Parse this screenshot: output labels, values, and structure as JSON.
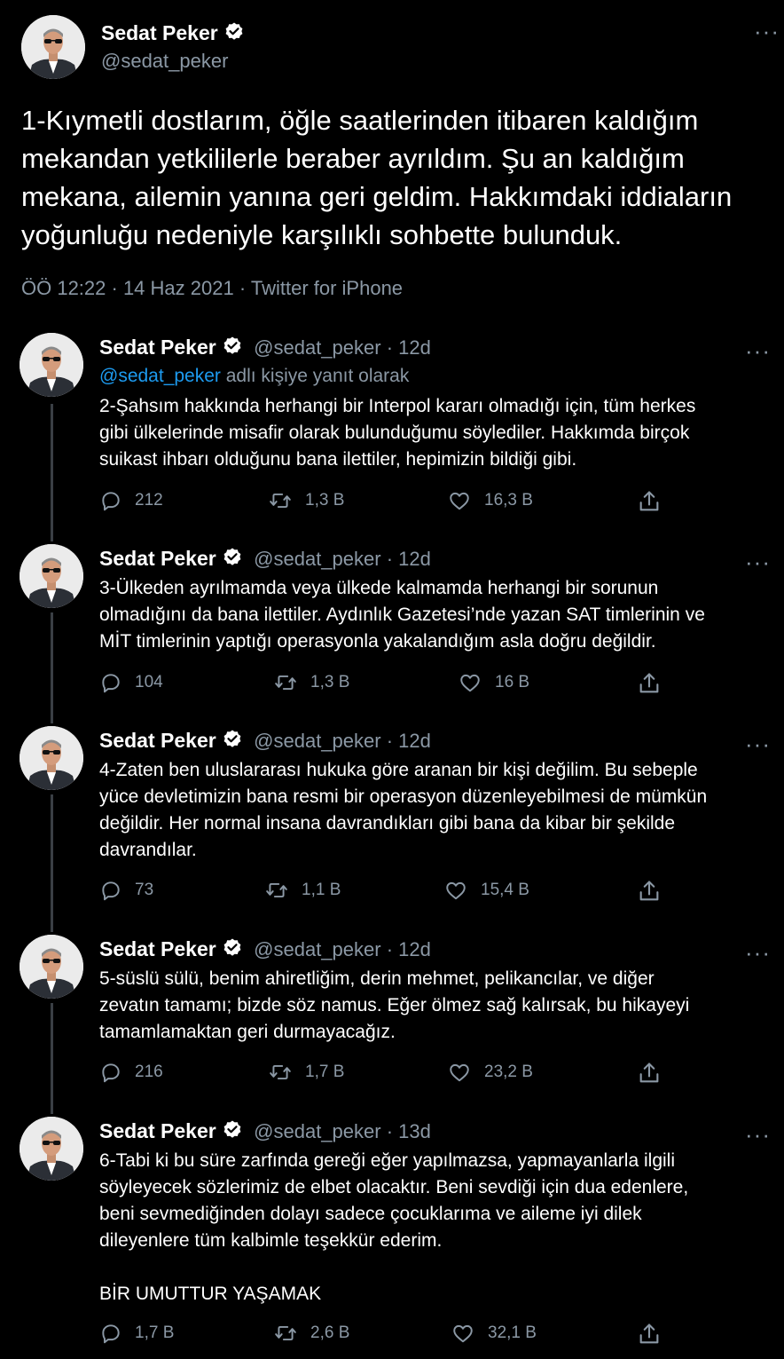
{
  "main_tweet": {
    "author_name": "Sedat Peker",
    "author_handle": "@sedat_peker",
    "text_lines": [
      "1-Kıymetli dostlarım, öğle saatlerinden itibaren kaldığım",
      "mekandan yetkililerle beraber ayrıldım. Şu an kaldığım",
      "mekana, ailemin yanına geri geldim. Hakkımdaki iddiaların",
      "yoğunluğu nedeniyle karşılıklı sohbette bulunduk."
    ],
    "meta": "ÖÖ 12:22 · 14 Haz 2021 · Twitter for iPhone",
    "more": "···"
  },
  "replies": [
    {
      "name": "Sedat Peker",
      "handle_time": "@sedat_peker · 12d",
      "reply_to_mention": "@sedat_peker",
      "reply_to_suffix": " adlı kişiye yanıt olarak",
      "text_lines": [
        "2-Şahsım hakkında herhangi bir Interpol kararı olmadığı için, tüm herkes",
        "gibi ülkelerinde misafir olarak bulunduğumu söylediler. Hakkımda birçok",
        "suikast ihbarı olduğunu bana ilettiler, hepimizin bildiği gibi."
      ],
      "replies": "212",
      "retweets": "1,3 B",
      "likes": "16,3 B",
      "more": "···"
    },
    {
      "name": "Sedat Peker",
      "handle_time": "@sedat_peker · 12d",
      "text_lines": [
        "3-Ülkeden ayrılmamda veya ülkede kalmamda herhangi bir sorunun",
        "olmadığını da bana ilettiler. Aydınlık Gazetesi’nde yazan SAT timlerinin ve",
        "MİT timlerinin yaptığı operasyonla yakalandığım asla doğru değildir."
      ],
      "replies": "104",
      "retweets": "1,3 B",
      "likes": "16 B",
      "more": "···"
    },
    {
      "name": "Sedat Peker",
      "handle_time": "@sedat_peker · 12d",
      "text_lines": [
        "4-Zaten ben uluslararası hukuka göre aranan bir kişi değilim. Bu sebeple",
        "yüce devletimizin bana resmi bir operasyon düzenleyebilmesi de mümkün",
        "değildir. Her normal insana davrandıkları gibi bana da kibar bir şekilde",
        "davrandılar."
      ],
      "replies": "73",
      "retweets": "1,1 B",
      "likes": "15,4 B",
      "more": "···"
    },
    {
      "name": "Sedat Peker",
      "handle_time": "@sedat_peker · 12d",
      "text_lines": [
        "5-süslü sülü, benim ahiretliğim, derin mehmet, pelikancılar, ve diğer",
        "zevatın tamamı; bizde söz namus. Eğer ölmez sağ kalırsak, bu hikayeyi",
        "tamamlamaktan geri durmayacağız."
      ],
      "replies": "216",
      "retweets": "1,7 B",
      "likes": "23,2 B",
      "more": "···"
    },
    {
      "name": "Sedat Peker",
      "handle_time": "@sedat_peker · 13d",
      "text_lines": [
        "6-Tabi ki bu süre zarfında gereği eğer yapılmazsa, yapmayanlarla ilgili",
        "söyleyecek sözlerimiz de elbet olacaktır. Beni sevdiği için dua edenlere,",
        "beni sevmediğinden dolayı sadece çocuklarıma ve aileme iyi dilek",
        "dileyenlere tüm kalbimle teşekkür ederim.",
        "",
        "BİR UMUTTUR YAŞAMAK"
      ],
      "replies": "1,7 B",
      "retweets": "2,6 B",
      "likes": "32,1 B",
      "more": "···"
    }
  ],
  "colors": {
    "background": "#000000",
    "text": "#ffffff",
    "secondary": "#8b98a5",
    "link": "#1d9bf0",
    "thread_line": "#3a3f45"
  },
  "icons": [
    "verified-badge-icon",
    "reply-icon",
    "retweet-icon",
    "like-icon",
    "share-icon",
    "more-icon"
  ]
}
